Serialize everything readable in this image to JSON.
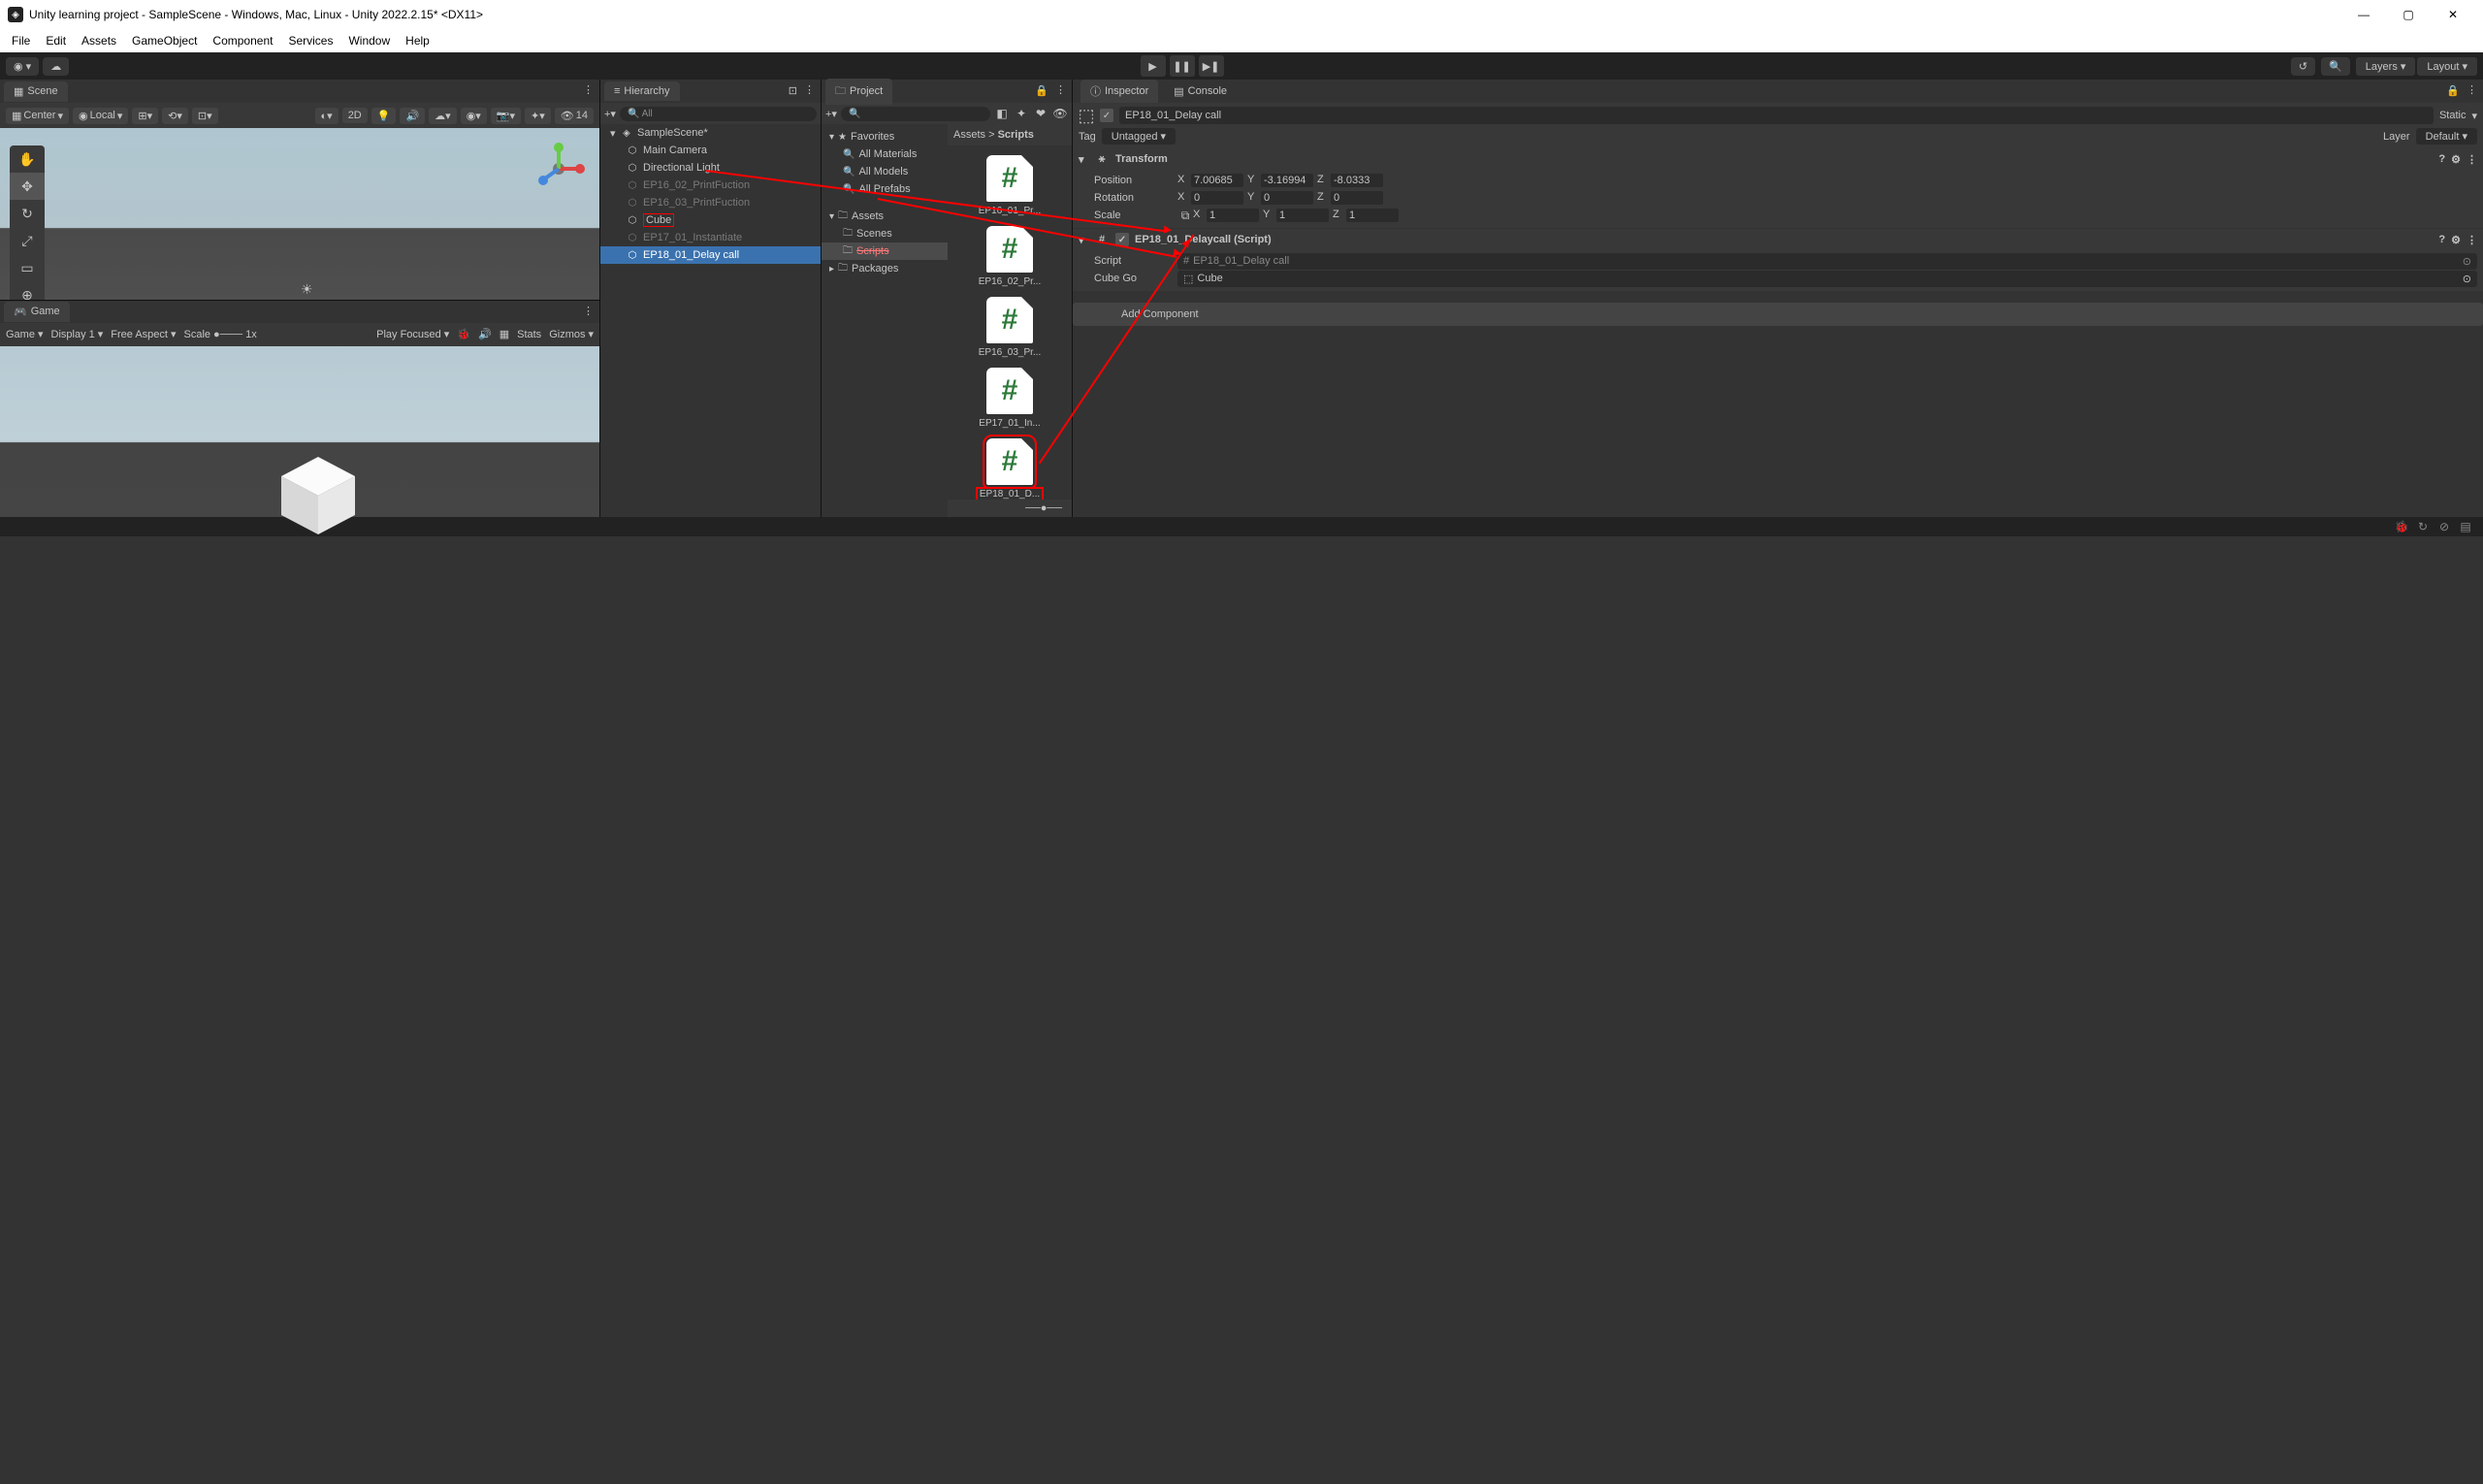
{
  "window": {
    "title": "Unity learning project - SampleScene - Windows, Mac, Linux - Unity 2022.2.15* <DX11>"
  },
  "menubar": [
    "File",
    "Edit",
    "Assets",
    "GameObject",
    "Component",
    "Services",
    "Window",
    "Help"
  ],
  "toolbar": {
    "layers": "Layers",
    "layout": "Layout"
  },
  "scene": {
    "tab": "Scene",
    "center": "Center",
    "local": "Local",
    "mode2d": "2D",
    "hidden_count": "14"
  },
  "game": {
    "tab": "Game",
    "game_drop": "Game",
    "display": "Display 1",
    "aspect": "Free Aspect",
    "scale_label": "Scale",
    "scale_val": "1x",
    "play_focused": "Play Focused",
    "stats": "Stats",
    "gizmos": "Gizmos"
  },
  "hierarchy": {
    "tab": "Hierarchy",
    "search_placeholder": "All",
    "scene_name": "SampleScene*",
    "items": [
      {
        "name": "Main Camera",
        "dim": false
      },
      {
        "name": "Directional Light",
        "dim": false
      },
      {
        "name": "EP16_02_PrintFuction",
        "dim": true
      },
      {
        "name": "EP16_03_PrintFuction",
        "dim": true
      },
      {
        "name": "Cube",
        "dim": false,
        "redbox": true
      },
      {
        "name": "EP17_01_Instantiate",
        "dim": true
      },
      {
        "name": "EP18_01_Delay call",
        "dim": false,
        "selected": true
      }
    ]
  },
  "project": {
    "tab": "Project",
    "search_placeholder": "",
    "favorites": "Favorites",
    "fav_items": [
      "All Materials",
      "All Models",
      "All Prefabs"
    ],
    "assets": "Assets",
    "asset_folders": [
      "Scenes",
      "Scripts",
      "Packages"
    ],
    "breadcrumb_root": "Assets",
    "breadcrumb_leaf": "Scripts",
    "scripts": [
      {
        "label": "EP16_01_Pr..."
      },
      {
        "label": "EP16_02_Pr..."
      },
      {
        "label": "EP16_03_Pr..."
      },
      {
        "label": "EP17_01_In..."
      },
      {
        "label": "EP18_01_D...",
        "redsel": true
      }
    ]
  },
  "inspector": {
    "tab_inspector": "Inspector",
    "tab_console": "Console",
    "obj_name": "EP18_01_Delay call",
    "static_label": "Static",
    "tag_label": "Tag",
    "tag_value": "Untagged",
    "layer_label": "Layer",
    "layer_value": "Default",
    "transform": {
      "title": "Transform",
      "position_label": "Position",
      "rotation_label": "Rotation",
      "scale_label": "Scale",
      "pos": {
        "x": "7.00685",
        "y": "-3.16994",
        "z": "-8.0333"
      },
      "rot": {
        "x": "0",
        "y": "0",
        "z": "0"
      },
      "scl": {
        "x": "1",
        "y": "1",
        "z": "1"
      }
    },
    "script_comp": {
      "title": "EP18_01_Delaycall (Script)",
      "script_label": "Script",
      "script_value": "EP18_01_Delay call",
      "cube_label": "Cube Go",
      "cube_value": "Cube"
    },
    "add_component": "Add Component"
  }
}
